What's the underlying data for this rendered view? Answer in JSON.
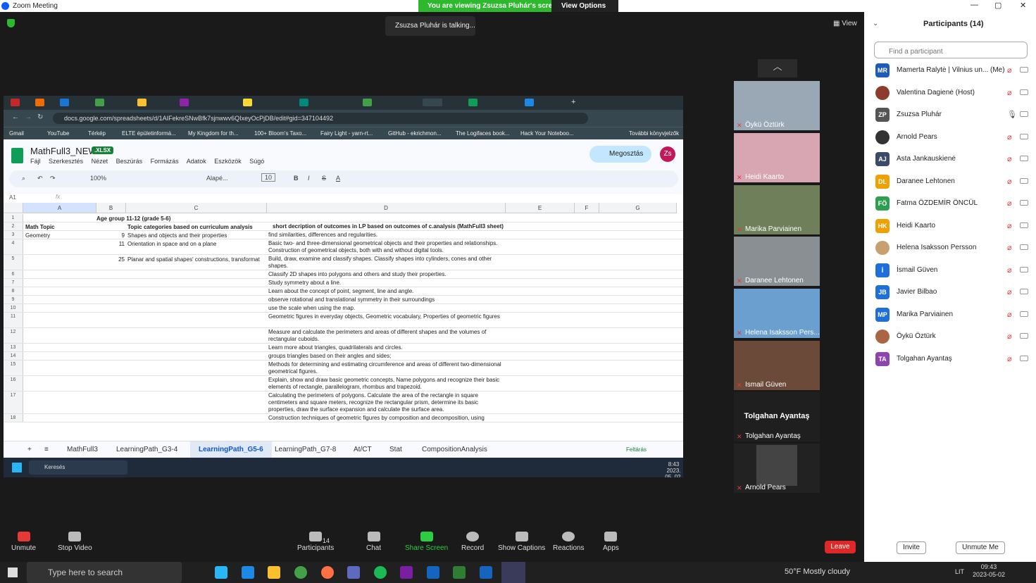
{
  "window": {
    "title": "Zoom Meeting"
  },
  "banner": {
    "viewing": "You are viewing Zsuzsa Pluhár's screen",
    "view_options": "View Options"
  },
  "talking": "Zsuzsa Pluhár is talking...",
  "view_label": "View",
  "browser": {
    "url": "docs.google.com/spreadsheets/d/1AIFekreSNwBfk7sjnwwv6QIxeyOcPjDB/edit#gid=347104492",
    "bookmarks": [
      "Gmail",
      "YouTube",
      "Térkép",
      "ELTE épületinformá...",
      "My Kingdom for th...",
      "100+ Bloom's Taxo...",
      "Fairy Light - yarn-rt...",
      "GitHub - ekrichmon...",
      "The Logifaces book...",
      "Hack Your Noteboo...",
      "További könyvjelzők"
    ]
  },
  "sheet": {
    "title": "MathFull3_NEW",
    "ext": ".XLSX",
    "menus": [
      "Fájl",
      "Szerkesztés",
      "Nézet",
      "Beszúrás",
      "Formázás",
      "Adatok",
      "Eszközök",
      "Súgó"
    ],
    "share": "Megosztás",
    "avatar": "Zs",
    "zoom": "100%",
    "font": "Alapé...",
    "font_size": "10",
    "cell_ref": "A1",
    "columns": [
      "A",
      "B",
      "C",
      "D",
      "E",
      "F",
      "G"
    ],
    "rows": [
      {
        "n": "1",
        "a": "",
        "b": "Age group 11-12 (grade 5-6)",
        "c": "",
        "d": ""
      },
      {
        "n": "2",
        "a": "Math Topic",
        "b": "",
        "c": "Topic categories based on curriculum analysis",
        "d": "short decription of outcomes in LP based on outcomes of c.analysis (MathFull3 sheet)"
      },
      {
        "n": "3",
        "a": "Geometry",
        "b": "9",
        "c": "Shapes and objects and their properties",
        "d": "find similarities, differences and regularities."
      },
      {
        "n": "4",
        "a": "",
        "b": "11",
        "c": "Orientation in space and on a plane",
        "d": "Basic two- and three-dimensional geometrical objects and their properties and relationships. Construction of geometrical objects, both with and without digital tools."
      },
      {
        "n": "5",
        "a": "",
        "b": "25",
        "c": "Planar and spatial shapes' constructions, transformat",
        "d": "Build, draw, examine and classify shapes. Classify shapes into cylinders, cones and other shapes."
      },
      {
        "n": "6",
        "a": "",
        "b": "",
        "c": "",
        "d": "Classify 2D shapes into polygons and others and study their properties."
      },
      {
        "n": "7",
        "a": "",
        "b": "",
        "c": "",
        "d": "Study symmetry about a line."
      },
      {
        "n": "8",
        "a": "",
        "b": "",
        "c": "",
        "d": "Learn about the concept of point, segment, line and angle."
      },
      {
        "n": "9",
        "a": "",
        "b": "",
        "c": "",
        "d": "observe rotational and translational symmetry in their surroundings"
      },
      {
        "n": "10",
        "a": "",
        "b": "",
        "c": "",
        "d": "use the scale when using the map."
      },
      {
        "n": "11",
        "a": "",
        "b": "",
        "c": "",
        "d": "Geometric figures in everyday objects, Geometric vocabulary, Properties of geometric figures"
      },
      {
        "n": "12",
        "a": "",
        "b": "",
        "c": "",
        "d": "Measure and calculate the perimeters and areas of different shapes and the volumes of rectangular cuboids."
      },
      {
        "n": "13",
        "a": "",
        "b": "",
        "c": "",
        "d": "Learn more about triangles, quadrilaterals and circles."
      },
      {
        "n": "14",
        "a": "",
        "b": "",
        "c": "",
        "d": "groups triangles based on their angles and sides;"
      },
      {
        "n": "15",
        "a": "",
        "b": "",
        "c": "",
        "d": "Methods for determining and estimating circumference and areas of different two-dimensional geometrical figures."
      },
      {
        "n": "16",
        "a": "",
        "b": "",
        "c": "",
        "d": "Explain, show and draw basic geometric concepts, Name polygons and recognize their basic elements of rectangle, parallelogram, rhombus and trapezoid."
      },
      {
        "n": "17",
        "a": "",
        "b": "",
        "c": "",
        "d": "Calculating the perimeters of polygons. Calculate the area of the rectangle in square centimeters and square meters, recognize the rectangular prism, determine its basic properties, draw the surface expansion and calculate the surface area."
      },
      {
        "n": "18",
        "a": "",
        "b": "",
        "c": "",
        "d": "Construction techniques of geometric figures by composition and decomposition, using"
      }
    ],
    "tabs": [
      "MathFull3",
      "LearningPath_G3-4",
      "LearningPath_G5-6",
      "LearningPath_G7-8",
      "At/CT",
      "Stat",
      "CompositionAnalysis"
    ],
    "active_tab": "LearningPath_G5-6",
    "explore": "Feltárás",
    "win_search": "Keresés",
    "win_time": "8:43",
    "win_date": "2023. 05. 02."
  },
  "gallery": [
    "Öykü Öztürk",
    "Heidi Kaarto",
    "Marika Parviainen",
    "Daranee Lehtonen",
    "Helena Isaksson Pers...",
    "Ismail Güven",
    "Tolgahan Ayantaş",
    "Arnold Pears"
  ],
  "gallery_big_name": "Tolgahan Ayantaş",
  "controls": {
    "unmute": "Unmute",
    "stop_video": "Stop Video",
    "participants": "Participants",
    "participants_count": "14",
    "chat": "Chat",
    "share": "Share Screen",
    "record": "Record",
    "captions": "Show Captions",
    "reactions": "Reactions",
    "apps": "Apps",
    "leave": "Leave"
  },
  "panel": {
    "title": "Participants (14)",
    "search_placeholder": "Find a participant",
    "participants": [
      {
        "initials": "MR",
        "name": "Mamerta Ralytė | Vilnius un... (Me)",
        "color": "#1e5bb8"
      },
      {
        "initials": "",
        "name": "Valentina Dagienė (Host)",
        "color": "#8d3b2a"
      },
      {
        "initials": "ZP",
        "name": "Zsuzsa Pluhár",
        "color": "#555555"
      },
      {
        "initials": "",
        "name": "Arnold Pears",
        "color": "#333333"
      },
      {
        "initials": "AJ",
        "name": "Asta Jankauskienė",
        "color": "#3a4a6b"
      },
      {
        "initials": "DL",
        "name": "Daranee Lehtonen",
        "color": "#f0a000"
      },
      {
        "initials": "FÖ",
        "name": "Fatma ÖZDEMİR ÖNCÜL",
        "color": "#2e9e4f"
      },
      {
        "initials": "HK",
        "name": "Heidi Kaarto",
        "color": "#f0a000"
      },
      {
        "initials": "",
        "name": "Helena Isaksson Persson",
        "color": "#c8a070"
      },
      {
        "initials": "İ",
        "name": "İsmail Güven",
        "color": "#1e6fd9"
      },
      {
        "initials": "JB",
        "name": "Javier Bilbao",
        "color": "#1e6fd9"
      },
      {
        "initials": "MP",
        "name": "Marika Parviainen",
        "color": "#1e6fd9"
      },
      {
        "initials": "",
        "name": "Öykü Öztürk",
        "color": "#aa6644"
      },
      {
        "initials": "TA",
        "name": "Tolgahan Ayantaş",
        "color": "#8e44ad"
      }
    ],
    "invite": "Invite",
    "unmute_me": "Unmute Me"
  },
  "taskbar": {
    "search": "Type here to search",
    "weather": "50°F  Mostly cloudy",
    "lang": "LIT",
    "time": "09:43",
    "date": "2023-05-02"
  }
}
